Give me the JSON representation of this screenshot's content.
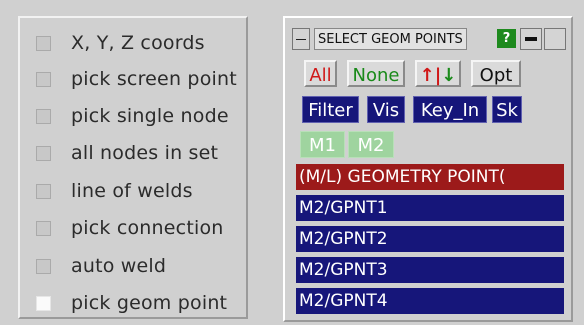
{
  "options": [
    {
      "label": "X, Y, Z coords",
      "checked": false
    },
    {
      "label": "pick screen point",
      "checked": false
    },
    {
      "label": "pick single node",
      "checked": false
    },
    {
      "label": "all nodes in set",
      "checked": false
    },
    {
      "label": "line of welds",
      "checked": false
    },
    {
      "label": "pick connection",
      "checked": false
    },
    {
      "label": "auto weld",
      "checked": false
    },
    {
      "label": "pick geom point",
      "checked": true
    }
  ],
  "panel": {
    "title": "SELECT GEOM POINTS",
    "help_label": "?",
    "buttons_row1": {
      "all": "All",
      "none": "None",
      "sort_up": "↑",
      "sort_down": "↓",
      "opt": "Opt"
    },
    "buttons_row2": {
      "filter": "Filter",
      "vis": "Vis",
      "key_in": "Key_In",
      "sk": "Sk"
    },
    "modes": {
      "m1": "M1",
      "m2": "M2"
    },
    "list_header": "(M/L) GEOMETRY POINT(",
    "items": [
      "M2/GPNT1",
      "M2/GPNT2",
      "M2/GPNT3",
      "M2/GPNT4"
    ]
  },
  "colors": {
    "all_text": "#d01818",
    "none_text": "#1a8a1a",
    "sort_up": "#d01818",
    "sort_down": "#1a8a1a",
    "selection_blue": "#16167a",
    "header_red": "#9c1a1a",
    "help_green": "#1e8a1e"
  }
}
